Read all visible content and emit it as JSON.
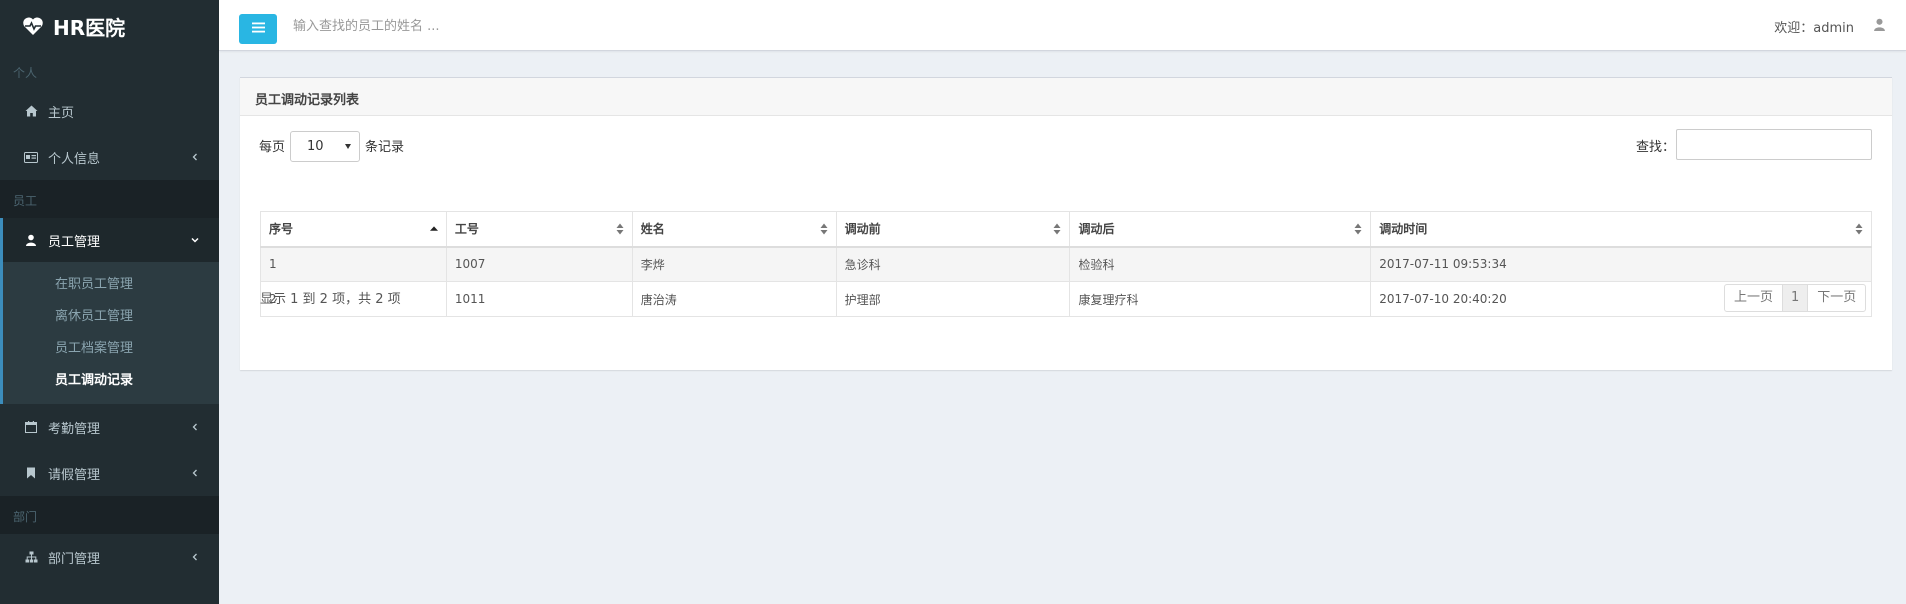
{
  "app": {
    "title": "HR医院"
  },
  "sidebar": {
    "sections": [
      "个人",
      "员工",
      "部门"
    ],
    "items": {
      "home": "主页",
      "personal_info": "个人信息",
      "employee_mgmt": "员工管理",
      "attendance_mgmt": "考勤管理",
      "leave_mgmt": "请假管理",
      "department_mgmt": "部门管理"
    },
    "submenu": [
      "在职员工管理",
      "离休员工管理",
      "员工档案管理",
      "员工调动记录"
    ]
  },
  "header": {
    "search_placeholder": "输入查找的员工的姓名 ...",
    "welcome": "欢迎：admin"
  },
  "box": {
    "title": "员工调动记录列表"
  },
  "controls": {
    "length_prefix": "每页",
    "length_value": "10",
    "length_suffix": "条记录",
    "search_label": "查找："
  },
  "table": {
    "columns": [
      "序号",
      "工号",
      "姓名",
      "调动前",
      "调动后",
      "调动时间"
    ],
    "rows": [
      [
        "1",
        "1007",
        "李烨",
        "急诊科",
        "检验科",
        "2017-07-11 09:53:34"
      ],
      [
        "2",
        "1011",
        "唐治涛",
        "护理部",
        "康复理疗科",
        "2017-07-10 20:40:20"
      ]
    ]
  },
  "footer": {
    "info": "显示 1 到 2 项，共 2 项",
    "prev": "上一页",
    "page": "1",
    "next": "下一页"
  },
  "colors": {
    "sidebar_bg": "#222d32",
    "accent": "#3c8dbc",
    "toggle_bg": "#29b6e3"
  }
}
